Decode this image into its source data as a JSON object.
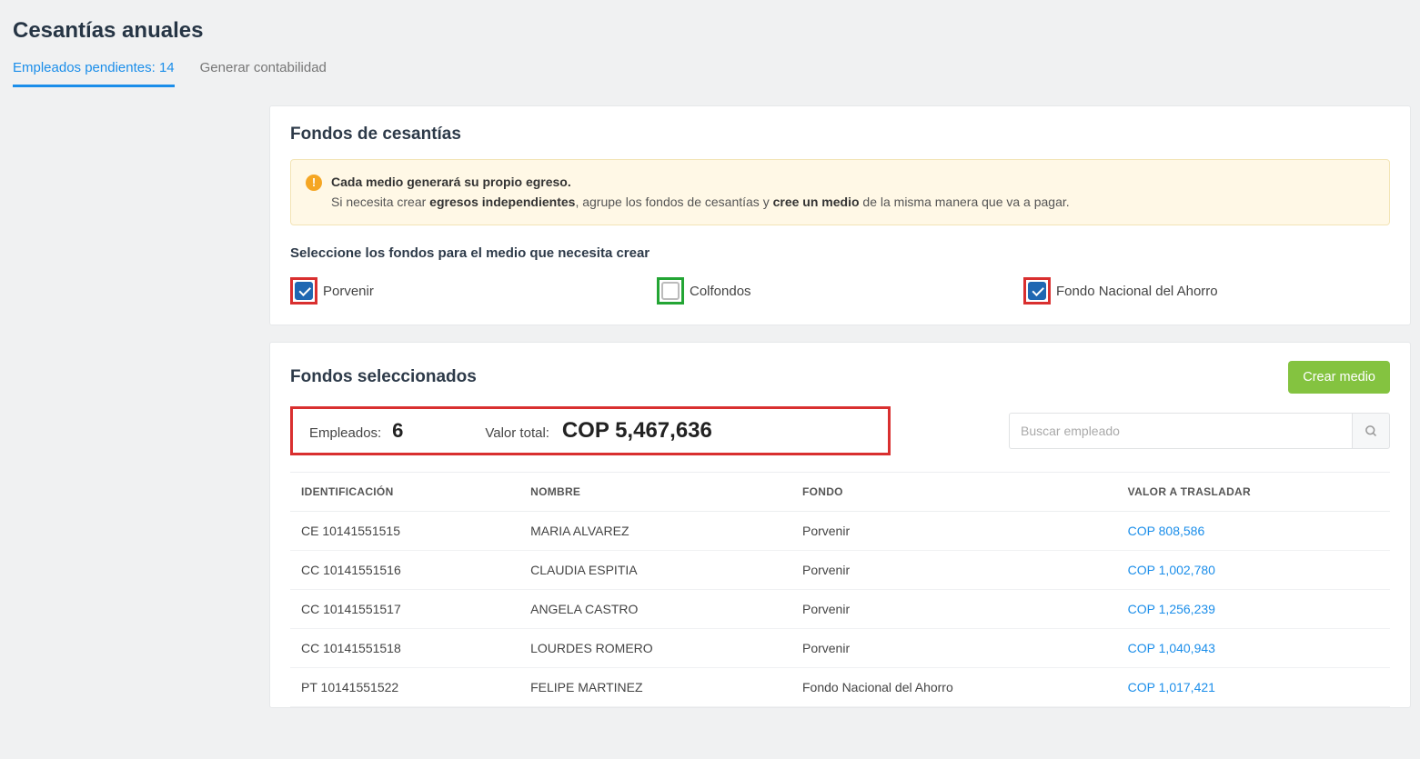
{
  "page": {
    "title": "Cesantías anuales"
  },
  "tabs": {
    "pending": "Empleados pendientes: 14",
    "accounting": "Generar contabilidad"
  },
  "fundsPanel": {
    "title": "Fondos de cesantías",
    "alert": {
      "line1_bold": "Cada medio generará su propio egreso.",
      "line2_pre": "Si necesita crear ",
      "line2_bold1": "egresos independientes",
      "line2_mid": ", agrupe los fondos de cesantías y ",
      "line2_bold2": "cree un medio",
      "line2_post": " de la misma manera que va a pagar."
    },
    "selectLabel": "Seleccione los fondos para el medio que necesita crear",
    "funds": [
      {
        "label": "Porvenir",
        "checked": true,
        "highlight": "red"
      },
      {
        "label": "Colfondos",
        "checked": false,
        "highlight": "green"
      },
      {
        "label": "Fondo Nacional del Ahorro",
        "checked": true,
        "highlight": "red"
      }
    ]
  },
  "selectedPanel": {
    "title": "Fondos seleccionados",
    "createBtn": "Crear medio",
    "employeesLabel": "Empleados:",
    "employeesCount": "6",
    "totalLabel": "Valor total:",
    "totalValue": "COP 5,467,636",
    "searchPlaceholder": "Buscar empleado",
    "columns": {
      "id": "IDENTIFICACIÓN",
      "name": "NOMBRE",
      "fund": "FONDO",
      "value": "VALOR A TRASLADAR"
    },
    "rows": [
      {
        "id": "CE 10141551515",
        "name": "MARIA ALVAREZ",
        "fund": "Porvenir",
        "value": "COP 808,586"
      },
      {
        "id": "CC 10141551516",
        "name": "CLAUDIA ESPITIA",
        "fund": "Porvenir",
        "value": "COP 1,002,780"
      },
      {
        "id": "CC 10141551517",
        "name": "ANGELA CASTRO",
        "fund": "Porvenir",
        "value": "COP 1,256,239"
      },
      {
        "id": "CC 10141551518",
        "name": "LOURDES ROMERO",
        "fund": "Porvenir",
        "value": "COP 1,040,943"
      },
      {
        "id": "PT 10141551522",
        "name": "FELIPE MARTINEZ",
        "fund": "Fondo Nacional del Ahorro",
        "value": "COP 1,017,421"
      }
    ]
  }
}
